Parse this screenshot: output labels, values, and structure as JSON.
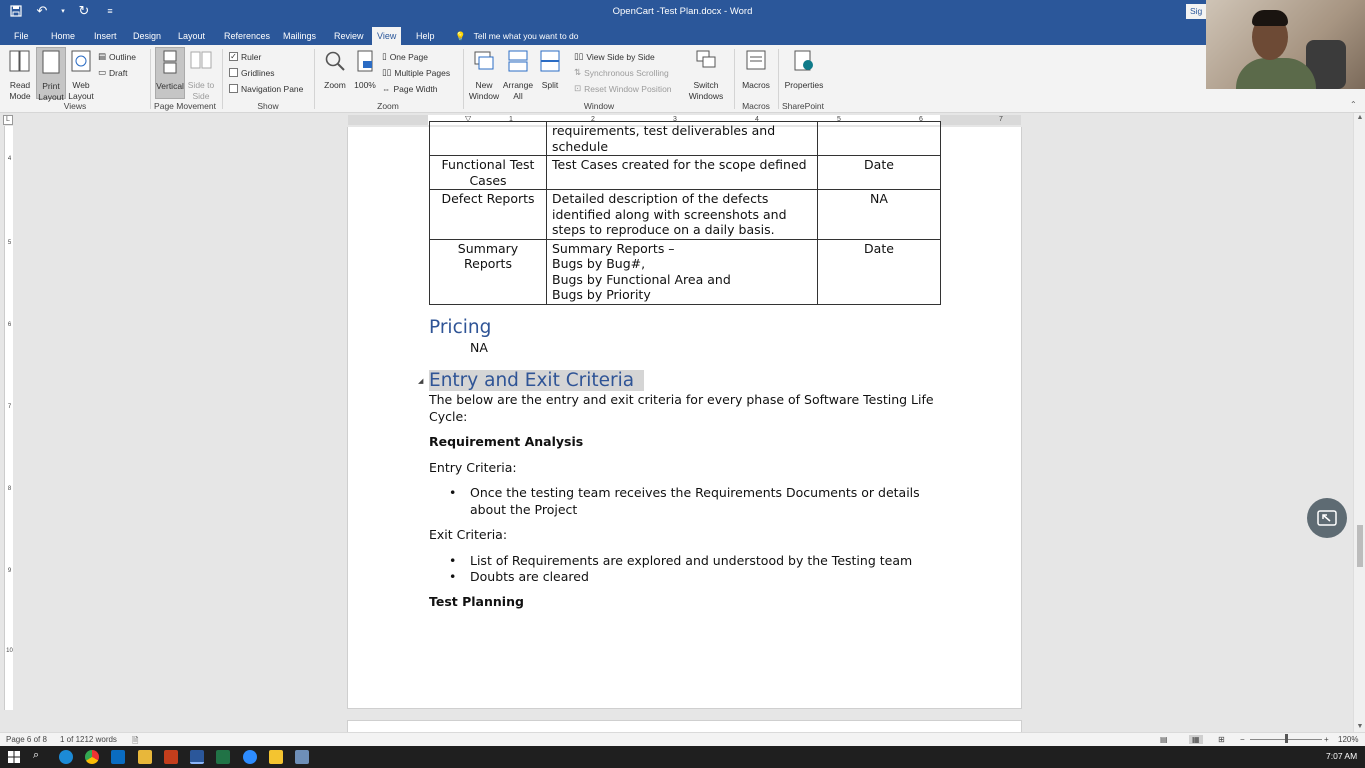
{
  "window": {
    "title": "OpenCart -Test Plan.docx - Word",
    "signin": "Sig"
  },
  "tabs": [
    "File",
    "Home",
    "Insert",
    "Design",
    "Layout",
    "References",
    "Mailings",
    "Review",
    "View",
    "Help"
  ],
  "active_tab": "View",
  "tell_me": "Tell me what you want to do",
  "ribbon": {
    "views": {
      "read_mode": "Read Mode",
      "print_layout": "Print Layout",
      "web_layout": "Web Layout",
      "outline": "Outline",
      "draft": "Draft",
      "group": "Views"
    },
    "page_movement": {
      "vertical": "Vertical",
      "side_to_side": "Side to Side",
      "group": "Page Movement"
    },
    "show": {
      "ruler": "Ruler",
      "gridlines": "Gridlines",
      "navigation_pane": "Navigation Pane",
      "group": "Show",
      "ruler_checked": true,
      "gridlines_checked": false,
      "nav_checked": false
    },
    "zoom": {
      "zoom": "Zoom",
      "hundred": "100%",
      "one_page": "One Page",
      "multiple_pages": "Multiple Pages",
      "page_width": "Page Width",
      "group": "Zoom"
    },
    "window": {
      "new_window": "New Window",
      "arrange_all": "Arrange All",
      "split": "Split",
      "view_side_by_side": "View Side by Side",
      "sync_scrolling": "Synchronous Scrolling",
      "reset_window": "Reset Window Position",
      "switch_windows": "Switch Windows",
      "group": "Window"
    },
    "macros": {
      "label": "Macros",
      "group": "Macros"
    },
    "sharepoint": {
      "label": "Properties",
      "group": "SharePoint"
    }
  },
  "ruler": {
    "numbers": [
      "1",
      "2",
      "3",
      "4",
      "5",
      "6",
      "7"
    ],
    "vnumbers": [
      "4",
      "5",
      "6",
      "7",
      "8",
      "9",
      "10"
    ]
  },
  "document": {
    "table_rows": [
      {
        "c1": "",
        "c2": "requirements, test deliverables and schedule",
        "c3": ""
      },
      {
        "c1": "Functional Test Cases",
        "c2": "Test Cases created for the scope defined",
        "c3": "Date"
      },
      {
        "c1": "Defect Reports",
        "c2": "Detailed description of the defects identified along with screenshots and steps to reproduce on a daily basis.",
        "c3": "NA"
      },
      {
        "c1": "Summary Reports",
        "c2": "Summary Reports –\nBugs by Bug#,\nBugs by Functional Area and\nBugs by Priority",
        "c3": "Date"
      }
    ],
    "pricing_heading": "Pricing",
    "pricing_value": "NA",
    "entry_exit_heading": "Entry and Exit Criteria",
    "intro": "The below are the entry and exit criteria for every phase of Software Testing Life Cycle:",
    "req_analysis": "Requirement Analysis",
    "entry_label": "Entry Criteria:",
    "entry_bullets": [
      "Once the testing team receives the Requirements Documents or details about the Project"
    ],
    "exit_label": "Exit Criteria:",
    "exit_bullets": [
      "List of Requirements are explored and understood by the Testing team",
      "Doubts are cleared"
    ],
    "test_planning": "Test Planning"
  },
  "status": {
    "page": "Page 6 of 8",
    "words": "1 of 1212 words",
    "zoom": "120%"
  },
  "taskbar": {
    "time": "7:07 AM"
  }
}
